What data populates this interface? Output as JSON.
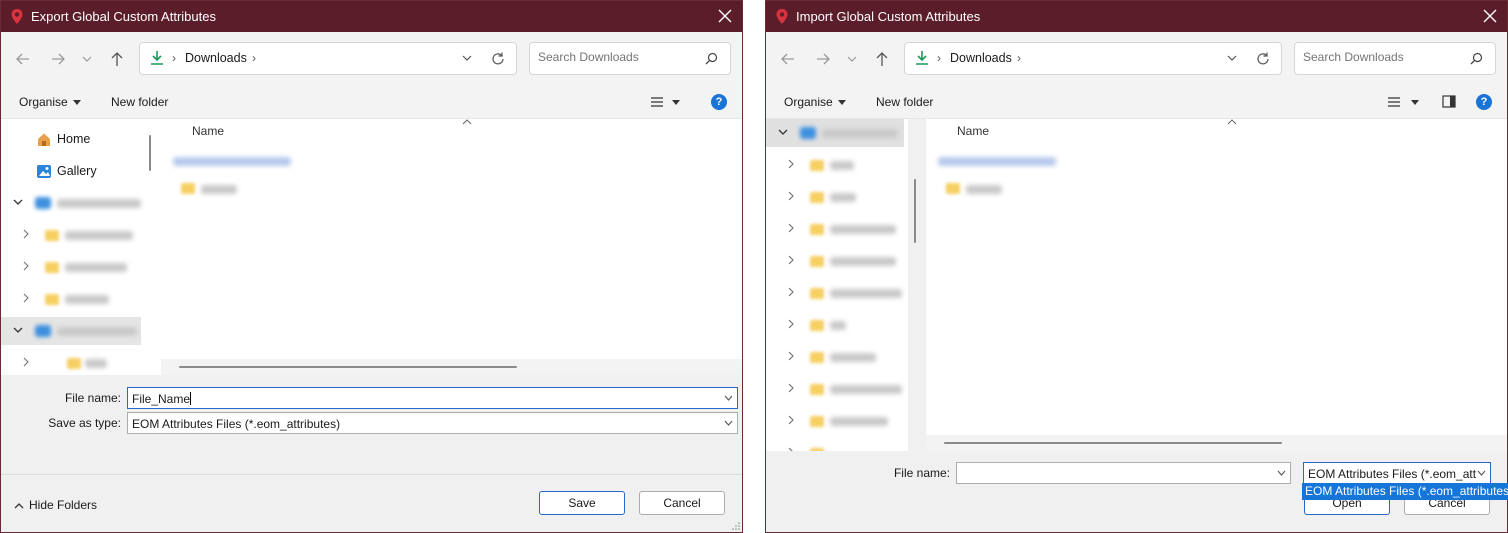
{
  "colors": {
    "titlebar": "#5b1d2a",
    "accent": "#1a73d6",
    "selected_option": "#1675d8"
  },
  "export_dialog": {
    "title": "Export Global Custom Attributes",
    "breadcrumb": "Downloads",
    "search_placeholder": "Search Downloads",
    "organise": "Organise",
    "new_folder": "New folder",
    "nav": [
      "Home",
      "Gallery"
    ],
    "column_name": "Name",
    "file_name_label": "File name:",
    "file_name_value": "File_Name",
    "save_type_label": "Save as type:",
    "save_type_value": "EOM Attributes Files (*.eom_attributes)",
    "hide_folders": "Hide Folders",
    "save": "Save",
    "cancel": "Cancel"
  },
  "import_dialog": {
    "title": "Import Global Custom Attributes",
    "breadcrumb": "Downloads",
    "search_placeholder": "Search Downloads",
    "organise": "Organise",
    "new_folder": "New folder",
    "column_name": "Name",
    "file_name_label": "File name:",
    "file_name_value": "",
    "file_type_value": "EOM Attributes Files (*.eom_att",
    "dropdown_option": "EOM Attributes Files (*.eom_attributes)",
    "open": "Open",
    "cancel": "Cancel"
  }
}
